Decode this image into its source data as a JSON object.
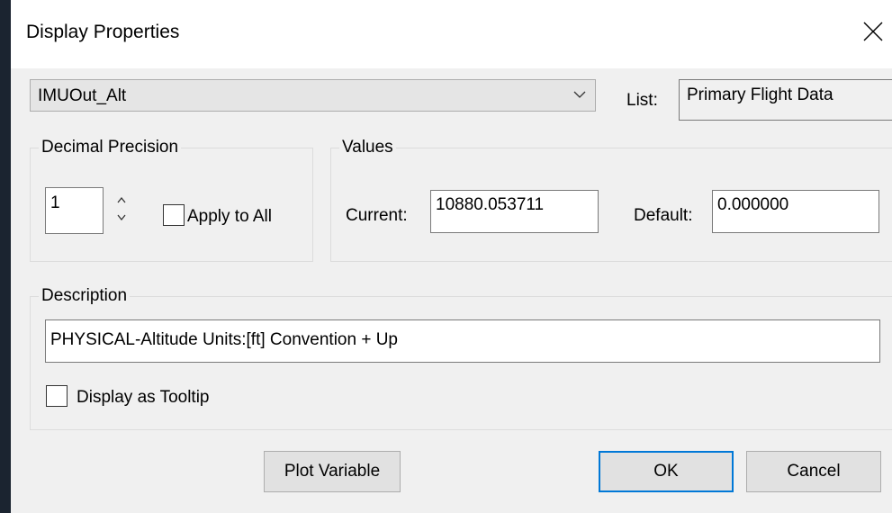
{
  "window": {
    "title": "Display Properties"
  },
  "variable_select": {
    "selected": "IMUOut_Alt"
  },
  "list": {
    "label": "List:",
    "value": "Primary Flight Data"
  },
  "decimal_precision": {
    "legend": "Decimal Precision",
    "value": "1",
    "apply_to_all_label": "Apply to All",
    "apply_to_all_checked": false
  },
  "values": {
    "legend": "Values",
    "current_label": "Current:",
    "current_value": "10880.053711",
    "default_label": "Default:",
    "default_value": "0.000000"
  },
  "description": {
    "legend": "Description",
    "text": "PHYSICAL-Altitude Units:[ft] Convention + Up",
    "tooltip_label": "Display as Tooltip",
    "tooltip_checked": false
  },
  "buttons": {
    "plot_variable": "Plot Variable",
    "ok": "OK",
    "cancel": "Cancel"
  },
  "colors": {
    "accent": "#0078d7",
    "dialog_bg": "#f0f0f0"
  }
}
